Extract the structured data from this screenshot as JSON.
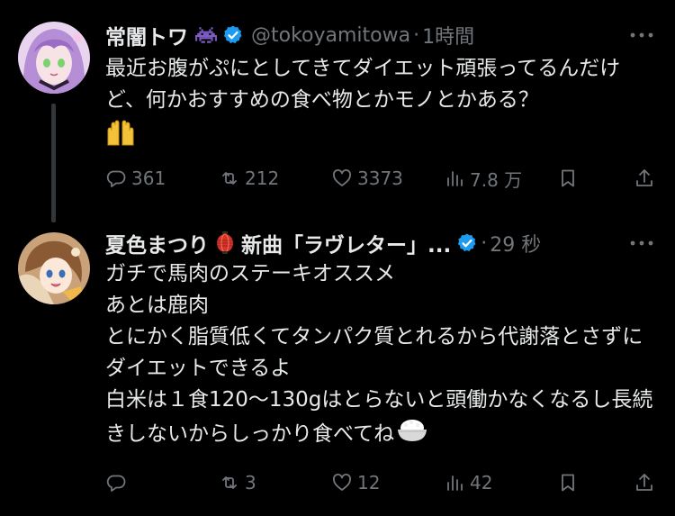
{
  "colors": {
    "background": "#000000",
    "text_primary": "#e7e9ea",
    "text_secondary": "#71767b",
    "verified_blue": "#1d9bf0",
    "thread_line": "#333639"
  },
  "tweets": [
    {
      "display_name": "常闇トワ",
      "name_emoji": "space-invader-icon",
      "handle": "@tokoyamitowa",
      "separator": "·",
      "time": "1時間",
      "body": "最近お腹がぷにとしてきてダイエット頑張ってるんだけど、何かおすすめの食べ物とかモノとかある？",
      "trailing_emoji": "raised-hands-icon",
      "actions": {
        "reply": "361",
        "retweet": "212",
        "like": "3373",
        "views": "7.8 万"
      }
    },
    {
      "display_name": "夏色まつり",
      "name_emoji": "lantern-icon",
      "name_suffix": "新曲「ラヴレター」...",
      "separator": "·",
      "time": "29 秒",
      "body": "ガチで馬肉のステーキオススメ\nあとは鹿肉\nとにかく脂質低くてタンパク質とれるから代謝落とさずにダイエットできるよ\n白米は１食120～130gはとらないと頭働かなくなるし長続きしないからしっかり食べてね",
      "trailing_emoji": "rice-bowl-icon",
      "actions": {
        "reply": "",
        "retweet": "3",
        "like": "12",
        "views": "42"
      }
    }
  ]
}
